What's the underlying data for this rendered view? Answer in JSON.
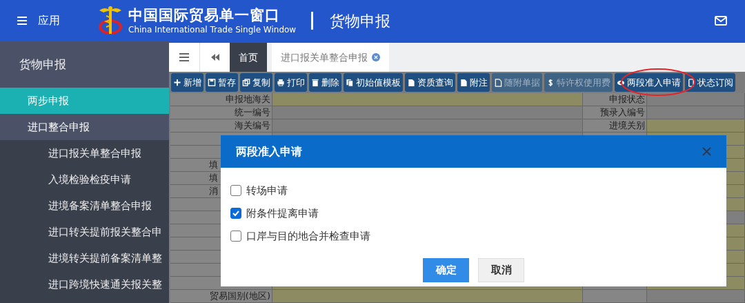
{
  "header": {
    "menu_label": "应用",
    "logo_title": "中国国际贸易单一窗口",
    "logo_subtitle": "China International Trade Single Window",
    "page_title": "货物申报"
  },
  "sidebar": {
    "title": "货物申报",
    "items": [
      {
        "label": "两步申报",
        "selected": true
      },
      {
        "label": "进口整合申报",
        "selected": false,
        "children": [
          {
            "label": "进口报关单整合申报",
            "selected": false
          },
          {
            "label": "入境检验检疫申请",
            "selected": false
          },
          {
            "label": "进境备案清单整合申报",
            "selected": false
          },
          {
            "label": "进口转关提前报关整合申",
            "selected": false
          },
          {
            "label": "进境转关提前备案清单整",
            "selected": false
          },
          {
            "label": "进口跨境快速通关报关整",
            "selected": false
          }
        ]
      }
    ]
  },
  "tabs": [
    {
      "label": "首页",
      "selected": false,
      "closable": false
    },
    {
      "label": "进口报关单整合申报",
      "selected": true,
      "closable": true
    }
  ],
  "toolbar": [
    {
      "label": "新增",
      "disabled": false
    },
    {
      "label": "暂存",
      "disabled": false
    },
    {
      "label": "复制",
      "disabled": false
    },
    {
      "label": "打印",
      "disabled": false
    },
    {
      "label": "删除",
      "disabled": false
    },
    {
      "label": "初始值模板",
      "disabled": false
    },
    {
      "label": "资质查询",
      "disabled": false
    },
    {
      "label": "附注",
      "disabled": false
    },
    {
      "label": "随附单据",
      "disabled": true
    },
    {
      "label": "特许权使用费",
      "disabled": true
    },
    {
      "label": "两段准入申请",
      "disabled": false
    },
    {
      "label": "状态订阅",
      "disabled": false
    }
  ],
  "form": {
    "rows": [
      {
        "cells": [
          {
            "label": "申报地海关"
          },
          {
            "required": true
          },
          {
            "label": "申报状态"
          },
          {
            "required": false
          }
        ]
      },
      {
        "cells": [
          {
            "label": "统一编号"
          },
          {
            "required": false
          },
          {
            "label": "预录入编号"
          },
          {
            "required": false
          }
        ]
      },
      {
        "cells": [
          {
            "label": "海关编号"
          },
          {
            "required": false
          },
          {
            "label": "进境关别"
          },
          {
            "required": true
          }
        ]
      },
      {
        "cells": [
          {},
          {
            "required": false
          },
          {},
          {
            "required": true
          }
        ]
      },
      {
        "cells": [
          {},
          {},
          {},
          {
            "required": true
          }
        ]
      },
      {
        "cells": [
          {
            "label": "填"
          },
          {},
          {},
          {
            "required": true
          }
        ]
      },
      {
        "cells": [
          {
            "label": "填"
          },
          {},
          {},
          {
            "required": true
          }
        ]
      },
      {
        "cells": [
          {
            "label": "消"
          },
          {},
          {},
          {
            "required": true
          }
        ]
      },
      {
        "cells": [
          {},
          {},
          {},
          {
            "required": true
          }
        ]
      },
      {
        "cells": [
          {},
          {},
          {},
          {
            "required": false
          }
        ]
      },
      {
        "cells": [
          {},
          {},
          {},
          {
            "required": true
          }
        ]
      },
      {
        "cells": [
          {},
          {},
          {},
          {
            "required": true
          }
        ]
      },
      {
        "cells": [
          {},
          {},
          {},
          {
            "required": true
          }
        ]
      },
      {
        "cells": [
          {},
          {},
          {},
          {
            "required": true
          }
        ]
      },
      {
        "cells": [
          {},
          {
            "required": true
          },
          {},
          {
            "required": true
          }
        ]
      },
      {
        "cells": [
          {
            "label": "贸易国别(地区)"
          },
          {
            "required": true
          },
          {},
          {
            "required": false
          }
        ]
      }
    ]
  },
  "dialog": {
    "title": "两段准入申请",
    "options": [
      {
        "label": "转场申请",
        "checked": false
      },
      {
        "label": "附条件提离申请",
        "checked": true
      },
      {
        "label": "口岸与目的地合并检查申请",
        "checked": false
      }
    ],
    "buttons": [
      {
        "label": "确定",
        "kind": "primary"
      },
      {
        "label": "取消",
        "kind": "default"
      }
    ]
  }
}
